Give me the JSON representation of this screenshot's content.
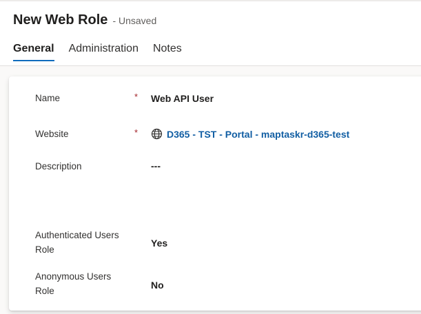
{
  "header": {
    "title": "New Web Role",
    "status": "- Unsaved"
  },
  "tabs": [
    {
      "label": "General",
      "active": true
    },
    {
      "label": "Administration",
      "active": false
    },
    {
      "label": "Notes",
      "active": false
    }
  ],
  "form": {
    "name": {
      "label": "Name",
      "required": "*",
      "value": "Web API User"
    },
    "website": {
      "label": "Website",
      "required": "*",
      "value": "D365 - TST - Portal - maptaskr-d365-test",
      "icon": "globe-icon"
    },
    "description": {
      "label": "Description",
      "value": "---"
    },
    "authenticated": {
      "label_line1": "Authenticated Users",
      "label_line2": "Role",
      "value": "Yes"
    },
    "anonymous": {
      "label_line1": "Anonymous Users",
      "label_line2": "Role",
      "value": "No"
    }
  },
  "colors": {
    "accent": "#0f6cbd",
    "link": "#115ea3",
    "required": "#a4262c"
  }
}
